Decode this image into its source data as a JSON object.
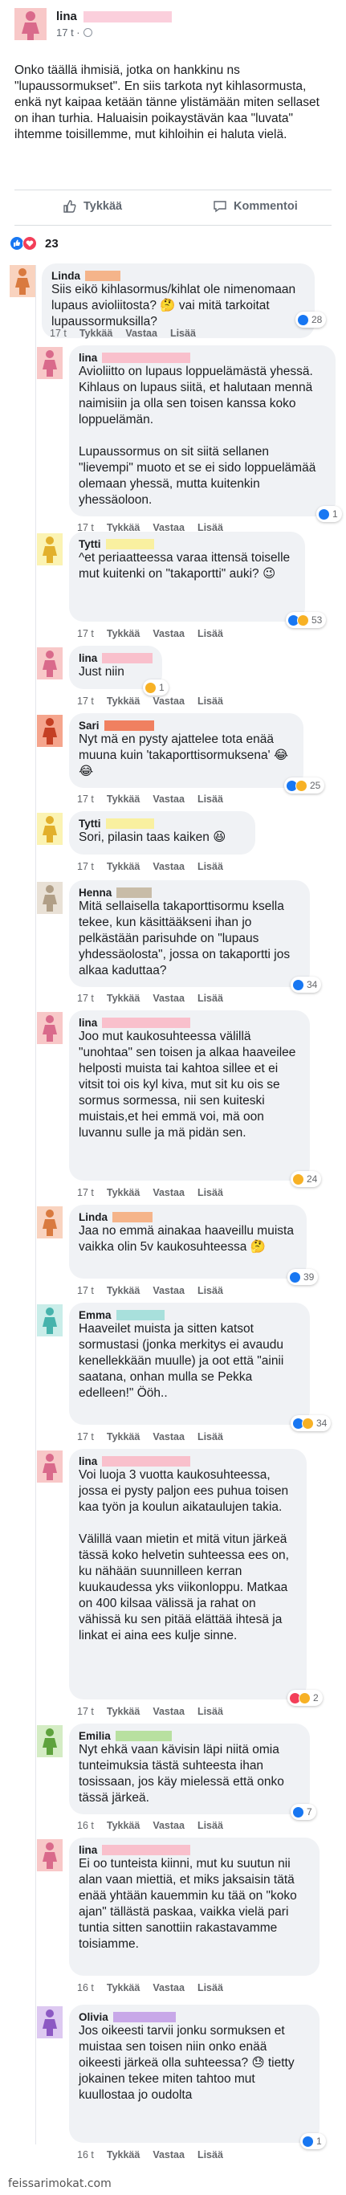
{
  "post": {
    "author": "lina",
    "meta": "17 t ·",
    "body": "Onko täällä ihmisiä, jotka on hankkinu ns \"lupaussormukset\". En siis tarkota nyt kihlasormusta, enkä nyt kaipaa ketään tänne ylistämään miten sellaset on ihan turhia. Haluaisin poikaystävän kaa \"luvata\" ihtemme toisillemme, mut kihloihin ei haluta vielä."
  },
  "actions": {
    "like_label": "Tykkää",
    "comment_label": "Kommentoi"
  },
  "reactions": {
    "count": "23"
  },
  "comment_actions": {
    "like": "Tykkää",
    "reply": "Vastaa",
    "more": "Lisää"
  },
  "comments": [
    {
      "name": "Linda",
      "text": "Siis eikö kihlasormus/kihlat ole nimenomaan lupaus avioliitosta? 🤔 vai mitä tarkoitat lupaussormuksilla?",
      "time": "17 t",
      "reaction_count": "28",
      "accent": "#f5b48a",
      "avatar": "#f9d3bf"
    },
    {
      "name": "lina",
      "text": "Avioliitto on lupaus loppuelämästä yhessä. Kihlaus on lupaus siitä, et halutaan mennä naimisiin ja olla sen toisen kanssa koko loppuelämän.\n\nLupaussormus on sit siitä sellanen \"lievempi\" muoto et se ei sido loppuelämää olemaan yhessä, mutta kuitenkin yhessäoloon.",
      "time": "17 t",
      "reaction_count": "1",
      "accent": "#f9c0cc",
      "avatar": "#f8c8c8"
    },
    {
      "name": "Tytti",
      "text": "^et periaatteessa varaa ittensä toiselle mut kuitenki on \"takaportti\" auki? 😉",
      "time": "17 t",
      "reaction_count": "53",
      "accent": "#f9f0a0",
      "avatar": "#fbf3b3"
    },
    {
      "name": "lina",
      "text": "Just niin",
      "time": "17 t",
      "reaction_count": "1",
      "accent": "#f9c0cc",
      "avatar": "#f8c8c8"
    },
    {
      "name": "Sari",
      "text": "Nyt mä en pysty ajattelee tota enää muuna kuin 'takaporttisormuksena' 😂😂",
      "time": "17 t",
      "reaction_count": "25",
      "accent": "#f08060",
      "avatar": "#f5a58d"
    },
    {
      "name": "Tytti",
      "text": "Sori, pilasin taas kaiken 😆",
      "time": "17 t",
      "reaction_count": "",
      "accent": "#f9f0a0",
      "avatar": "#fbf3b3"
    },
    {
      "name": "Henna",
      "text": "Mitä sellaisella takaporttisormu ksella tekee, kun käsittääkseni ihan jo pelkästään parisuhde on \"lupaus yhdessäolosta\", jossa on takaportti jos alkaa kaduttaa?",
      "time": "17 t",
      "reaction_count": "34",
      "accent": "#c8bca8",
      "avatar": "#e9e1d6"
    },
    {
      "name": "lina",
      "text": "Joo mut kaukosuhteessa välillä \"unohtaa\" sen toisen ja alkaa haaveilee helposti muista tai kahtoa sillee et ei vitsit toi ois kyl kiva, mut sit ku ois se sormus sormessa, nii sen kuiteski muistais,et hei emmä voi, mä oon luvannu sulle ja mä pidän sen.",
      "time": "17 t",
      "reaction_count": "24",
      "accent": "#f9c0cc",
      "avatar": "#f8c8c8"
    },
    {
      "name": "Linda",
      "text": "Jaa no emmä ainakaa haaveillu muista vaikka olin 5v kaukosuhteessa 🤔",
      "time": "17 t",
      "reaction_count": "39",
      "accent": "#f5b48a",
      "avatar": "#f9d3bf"
    },
    {
      "name": "Emma",
      "text": "Haaveilet muista ja sitten katsot sormustasi (jonka merkitys ei avaudu kenellekkään muulle) ja oot että \"ainii saatana, onhan mulla se Pekka edelleen!\" Ööh..",
      "time": "17 t",
      "reaction_count": "34",
      "accent": "#a8e0dc",
      "avatar": "#c9ede9"
    },
    {
      "name": "lina",
      "text": "Voi luoja 3 vuotta kaukosuhteessa, jossa ei pysty paljon ees puhua toisen kaa työn ja koulun aikataulujen takia.\n\nVälillä vaan mietin et mitä vitun järkeä tässä koko helvetin suhteessa ees on, ku nähään suunnilleen kerran kuukaudessa yks viikonloppu. Matkaa on 400 kilsaa välissä ja rahat on vähissä ku sen pitää elättää ihtesä ja linkat ei aina ees kulje sinne.",
      "time": "17 t",
      "reaction_count": "2",
      "accent": "#f9c0cc",
      "avatar": "#f8c8c8"
    },
    {
      "name": "Emilia",
      "text": "Nyt ehkä vaan kävisin läpi niitä omia tunteimuksia tästä suhteesta ihan tosissaan, jos käy mielessä että onko tässä järkeä.",
      "time": "16 t",
      "reaction_count": "7",
      "accent": "#b8e0a0",
      "avatar": "#d4ecc4"
    },
    {
      "name": "lina",
      "text": "Ei oo tunteista kiinni, mut ku suutun nii alan vaan miettiä, et miks jaksaisin tätä enää yhtään kauemmin ku tää on \"koko ajan\" tällästä paskaa, vaikka vielä pari tuntia sitten sanottiin rakastavamme toisiamme.",
      "time": "16 t",
      "reaction_count": "",
      "accent": "#f9c0cc",
      "avatar": "#f8c8c8"
    },
    {
      "name": "Olivia",
      "text": "Jos oikeesti tarvii jonku sormuksen et muistaa sen toisen niin onko enää oikeesti järkeä olla suhteessa? 😓 tietty jokainen tekee miten tahtoo mut kuullostaa jo oudolta",
      "time": "16 t",
      "reaction_count": "1",
      "accent": "#c8a8e8",
      "avatar": "#ddc9f1"
    }
  ],
  "footer": {
    "text": "feissarimokat.com"
  },
  "colors": {
    "like_blue": "#1877f2",
    "love_red": "#f33e58",
    "haha_yellow": "#f7b125",
    "bubble_bg": "#f0f2f5"
  }
}
